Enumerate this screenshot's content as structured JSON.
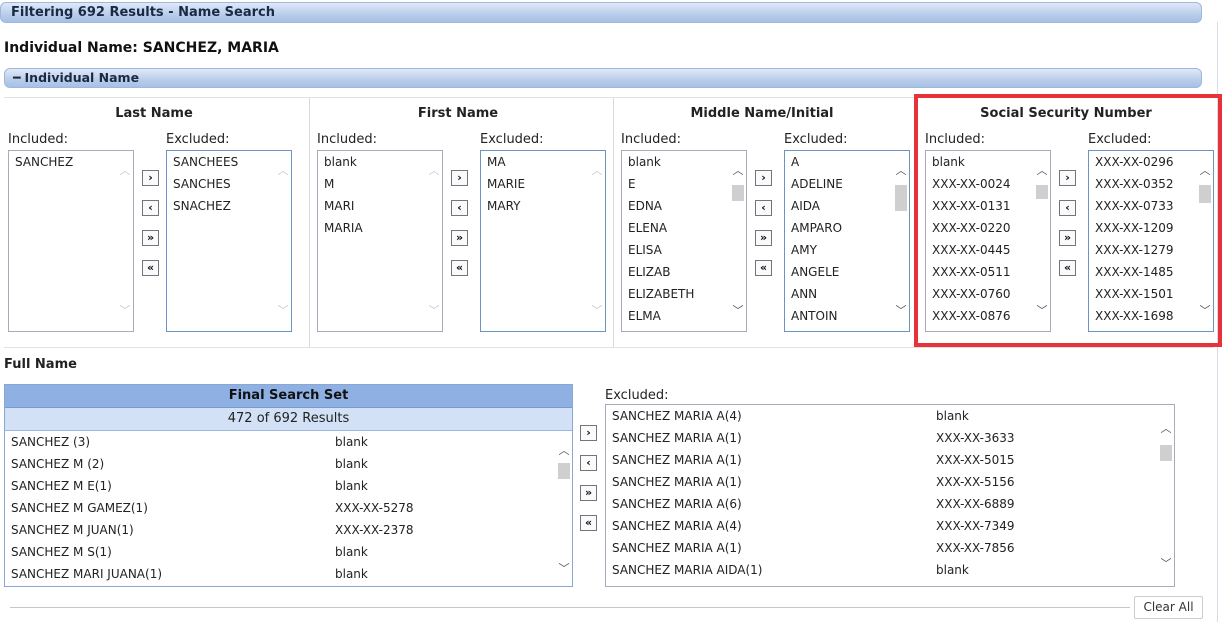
{
  "header": {
    "title": "Filtering 692 Results - Name Search"
  },
  "individual": {
    "title": "Individual Name: SANCHEZ, MARIA",
    "section_label": "Individual Name"
  },
  "last_name": {
    "title": "Last Name",
    "included_label": "Included:",
    "excluded_label": "Excluded:",
    "included": [
      "SANCHEZ"
    ],
    "excluded": [
      "SANCHEES",
      "SANCHES",
      "SNACHEZ"
    ]
  },
  "first_name": {
    "title": "First Name",
    "included_label": "Included:",
    "excluded_label": "Excluded:",
    "included": [
      "blank",
      "M",
      "MARI",
      "MARIA"
    ],
    "excluded": [
      "MA",
      "MARIE",
      "MARY"
    ]
  },
  "middle_name": {
    "title": "Middle Name/Initial",
    "included_label": "Included:",
    "excluded_label": "Excluded:",
    "included": [
      "blank",
      "E",
      "EDNA",
      "ELENA",
      "ELISA",
      "ELIZAB",
      "ELIZABETH",
      "ELMA"
    ],
    "excluded": [
      "A",
      "ADELINE",
      "AIDA",
      "AMPARO",
      "AMY",
      "ANGELE",
      "ANN",
      "ANTOIN"
    ]
  },
  "ssn": {
    "title": "Social Security Number",
    "included_label": "Included:",
    "excluded_label": "Excluded:",
    "included": [
      "blank",
      "XXX-XX-0024",
      "XXX-XX-0131",
      "XXX-XX-0220",
      "XXX-XX-0445",
      "XXX-XX-0511",
      "XXX-XX-0760",
      "XXX-XX-0876"
    ],
    "excluded": [
      "XXX-XX-0296",
      "XXX-XX-0352",
      "XXX-XX-0733",
      "XXX-XX-1209",
      "XXX-XX-1279",
      "XXX-XX-1485",
      "XXX-XX-1501",
      "XXX-XX-1698"
    ]
  },
  "move_buttons": {
    "move_right": "›",
    "move_left": "‹",
    "move_all_right": "»",
    "move_all_left": "«"
  },
  "full_name": {
    "title": "Full Name",
    "final_set_header": "Final Search Set",
    "final_set_count": "472 of 692 Results",
    "excluded_label": "Excluded:",
    "final_rows": [
      {
        "name": "SANCHEZ (3)",
        "ssn": "blank"
      },
      {
        "name": "SANCHEZ M (2)",
        "ssn": "blank"
      },
      {
        "name": "SANCHEZ M E(1)",
        "ssn": "blank"
      },
      {
        "name": "SANCHEZ M GAMEZ(1)",
        "ssn": "XXX-XX-5278"
      },
      {
        "name": "SANCHEZ M JUAN(1)",
        "ssn": "XXX-XX-2378"
      },
      {
        "name": "SANCHEZ M S(1)",
        "ssn": "blank"
      },
      {
        "name": "SANCHEZ MARI JUANA(1)",
        "ssn": "blank"
      }
    ],
    "excluded_rows": [
      {
        "name": "SANCHEZ MARIA A(4)",
        "ssn": "blank"
      },
      {
        "name": "SANCHEZ MARIA A(1)",
        "ssn": "XXX-XX-3633"
      },
      {
        "name": "SANCHEZ MARIA A(1)",
        "ssn": "XXX-XX-5015"
      },
      {
        "name": "SANCHEZ MARIA A(1)",
        "ssn": "XXX-XX-5156"
      },
      {
        "name": "SANCHEZ MARIA A(6)",
        "ssn": "XXX-XX-6889"
      },
      {
        "name": "SANCHEZ MARIA A(4)",
        "ssn": "XXX-XX-7349"
      },
      {
        "name": "SANCHEZ MARIA A(1)",
        "ssn": "XXX-XX-7856"
      },
      {
        "name": "SANCHEZ MARIA AIDA(1)",
        "ssn": "blank"
      }
    ]
  },
  "footer": {
    "clear_all": "Clear All"
  }
}
